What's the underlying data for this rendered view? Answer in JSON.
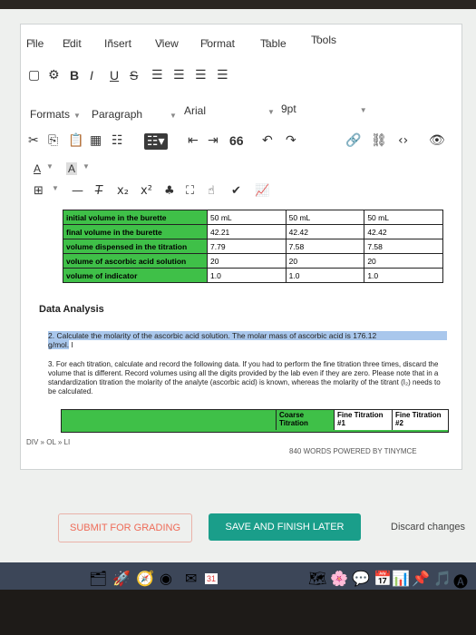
{
  "menu": {
    "items": [
      "File",
      "Edit",
      "Insert",
      "View",
      "Format",
      "Table",
      "Tools"
    ]
  },
  "toolbar": {
    "bold": "B",
    "italic": "I",
    "underline": "U",
    "strike": "S",
    "formats_label": "Formats",
    "paragraph_label": "Paragraph",
    "font_label": "Arial",
    "size_label": "9pt",
    "text_color_label": "A",
    "bg_color_label": "A",
    "quote_glyph": "66"
  },
  "table": {
    "rows": [
      {
        "label": "initial volume in the burette",
        "values": [
          "50 mL",
          "50 mL",
          "50 mL"
        ]
      },
      {
        "label": "final volume in the burette",
        "values": [
          "42.21",
          "42.42",
          "42.42"
        ]
      },
      {
        "label": "volume dispensed in the titration",
        "values": [
          "7.79",
          "7.58",
          "7.58"
        ]
      },
      {
        "label": "volume of ascorbic acid solution",
        "values": [
          "20",
          "20",
          "20"
        ]
      },
      {
        "label": "volume of indicator",
        "values": [
          "1.0",
          "1.0",
          "1.0"
        ]
      }
    ]
  },
  "analysis": {
    "heading": "Data Analysis",
    "q2_line1": "2.  Calculate the molarity of the ascorbic acid solution. The molar mass of ascorbic acid is 176.12",
    "q2_line2": "g/mol.",
    "q3_text": "3.  For each titration, calculate and record the following data. If you had to perform the fine titration three times, discard the volume that is different. Record volumes using all the digits provided by the lab even if they are zero. Please note that in a standardization titration the molarity of the analyte (ascorbic acid) is known, whereas the molarity of the titrant (I₂) needs to be calculated.",
    "col_coarse": "Coarse Titration",
    "col_fine1": "Fine Titration #1",
    "col_fine2": "Fine Titration #2"
  },
  "status": {
    "path": "DIV » OL » LI",
    "word_count": "840 WORDS POWERED BY TINYMCE"
  },
  "actions": {
    "submit": "SUBMIT FOR GRADING",
    "save": "SAVE AND FINISH LATER",
    "discard": "Discard changes"
  },
  "dock": {
    "calendar_day": "31"
  },
  "colors": {
    "table_label_green": "#3fc048",
    "save_button": "#1a9e8a",
    "submit_button": "#ef6b58",
    "selection_highlight": "#a9c7ec"
  }
}
